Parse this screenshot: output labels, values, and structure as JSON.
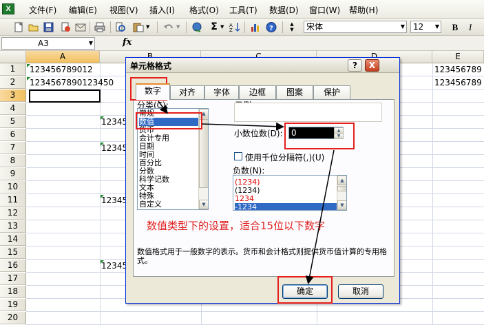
{
  "menu": {
    "items": [
      "文件(F)",
      "编辑(E)",
      "视图(V)",
      "插入(I)",
      "格式(O)",
      "工具(T)",
      "数据(D)",
      "窗口(W)",
      "帮助(H)"
    ]
  },
  "toolbar": {
    "font_name": "宋体",
    "font_size": "12",
    "bold": "B",
    "italic": "I",
    "sum": "Σ"
  },
  "formula_bar": {
    "name_box": "A3",
    "fx": "fx"
  },
  "sheet": {
    "columns": [
      "A",
      "B",
      "C",
      "D",
      "E"
    ],
    "rows": [
      "1",
      "2",
      "3",
      "4",
      "5",
      "6",
      "7",
      "8",
      "9",
      "10",
      "11",
      "12",
      "13",
      "14",
      "15",
      "16",
      "17",
      "18",
      "19",
      "20"
    ],
    "a1": "123456789012",
    "a2": "1234567890123450",
    "b5": "12345",
    "b7": "12345",
    "b11": "12345",
    "b16": "12345",
    "e1": "123456789",
    "e2": "123456789"
  },
  "dialog": {
    "title": "单元格格式",
    "help": "?",
    "close": "X",
    "tabs": [
      "数字",
      "对齐",
      "字体",
      "边框",
      "图案",
      "保护"
    ],
    "category_label": "分类(C):",
    "categories": [
      "常规",
      "数值",
      "货币",
      "会计专用",
      "日期",
      "时间",
      "百分比",
      "分数",
      "科学记数",
      "文本",
      "特殊",
      "自定义"
    ],
    "selected_category": "数值",
    "sample_label": "示例",
    "decimals_label": "小数位数(D):",
    "decimals_value": "0",
    "thousands_label": "使用千位分隔符(,)(U)",
    "negative_label": "负数(N):",
    "negatives": [
      "(1234)",
      "(1234)",
      "1234",
      "-1234"
    ],
    "annotation": "数值类型下的设置，适合15位以下数字",
    "description": "数值格式用于一般数字的表示。货币和会计格式则提供货币值计算的专用格式。",
    "ok": "确定",
    "cancel": "取消"
  }
}
